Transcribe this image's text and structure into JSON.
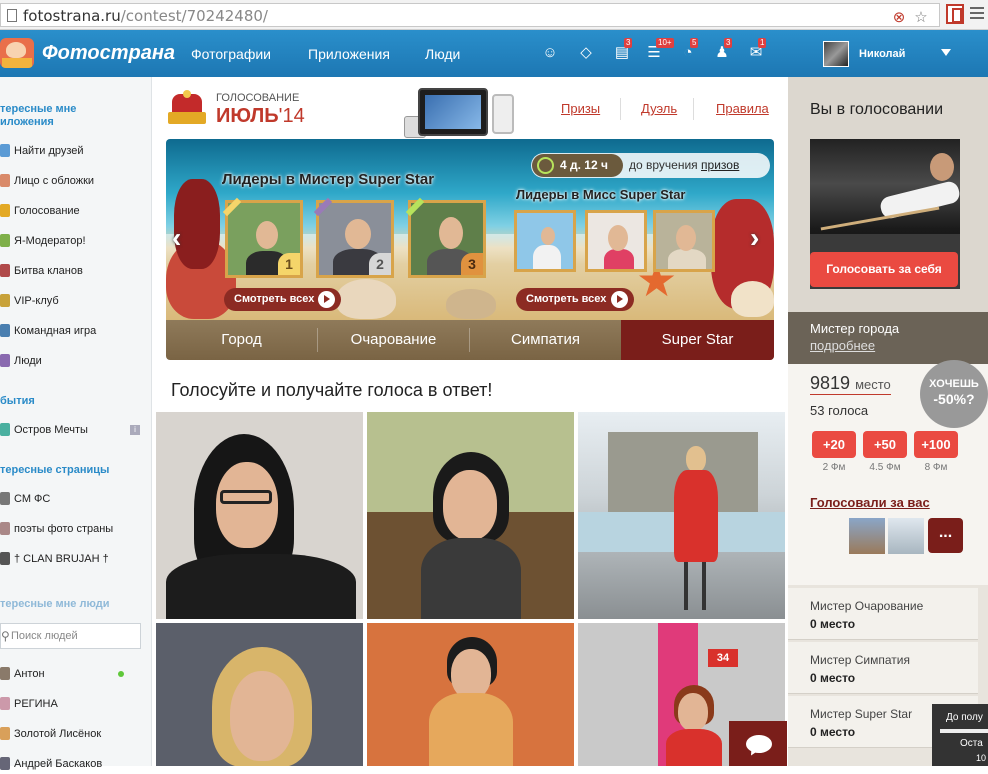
{
  "browser": {
    "url_host": "fotostrana.ru",
    "url_path": "/contest/70242480/"
  },
  "nav": {
    "logo": "Фотострана",
    "links": [
      "Фотографии",
      "Приложения",
      "Люди"
    ],
    "badges": [
      "3",
      "10+",
      "5",
      "3",
      "1"
    ],
    "user": "Николай"
  },
  "sidebar": {
    "apps_heading": "тересные мне\nиложения",
    "apps": [
      "Найти друзей",
      "Лицо с обложки",
      "Голосование",
      "Я-Модератор!",
      "Битва кланов",
      "VIP-клуб",
      "Командная игра",
      "Люди"
    ],
    "events_heading": "бытия",
    "events": [
      "Остров Мечты"
    ],
    "pages_heading": "тересные страницы",
    "pages": [
      "СМ ФС",
      "поэты фото страны",
      "† CLAN BRUJAH †"
    ],
    "people_heading": "тересные мне люди",
    "search_placeholder": "Поиск людей",
    "people": [
      "Антон",
      "РЕГИНА",
      "Золотой Лисёнок",
      "Андрей Баскаков"
    ]
  },
  "contest": {
    "label": "ГОЛОСОВАНИЕ",
    "month": "ИЮЛЬ",
    "year": "'14",
    "links": [
      "Призы",
      "Дуэль",
      "Правила"
    ]
  },
  "banner": {
    "mr_title": "Лидеры в Мистер Super Star",
    "miss_title": "Лидеры в Мисс Super Star",
    "ranks": [
      "1",
      "2",
      "3"
    ],
    "timer": "4 д. 12 ч",
    "timer_label": "до вручения",
    "timer_link": "призов",
    "see_all": "Смотреть всех"
  },
  "tabs": [
    "Город",
    "Очарование",
    "Симпатия",
    "Super Star"
  ],
  "heading": "Голосуйте и получайте голоса в ответ!",
  "right": {
    "title": "Вы в голосовании",
    "vote_self": "Голосовать за себя",
    "category": "Мистер города",
    "more": "подробнее",
    "position_num": "9819",
    "position_word": "место",
    "votes": "53 голоса",
    "want_a": "ХОЧЕШЬ",
    "want_b": "-50%?",
    "plus": [
      "+20",
      "+50",
      "+100"
    ],
    "fm": [
      "2 Фм",
      "4.5 Фм",
      "8 Фм"
    ],
    "voted_for_you": "Голосовали за вас",
    "more_btn": "...",
    "cats": [
      {
        "name": "Мистер Очарование",
        "place": "0 место"
      },
      {
        "name": "Мистер Симпатия",
        "place": "0 место"
      },
      {
        "name": "Мистер Super Star",
        "place": "0 место"
      }
    ]
  },
  "tooltip": {
    "a": "До полу",
    "b": "Оста",
    "c": "10"
  }
}
